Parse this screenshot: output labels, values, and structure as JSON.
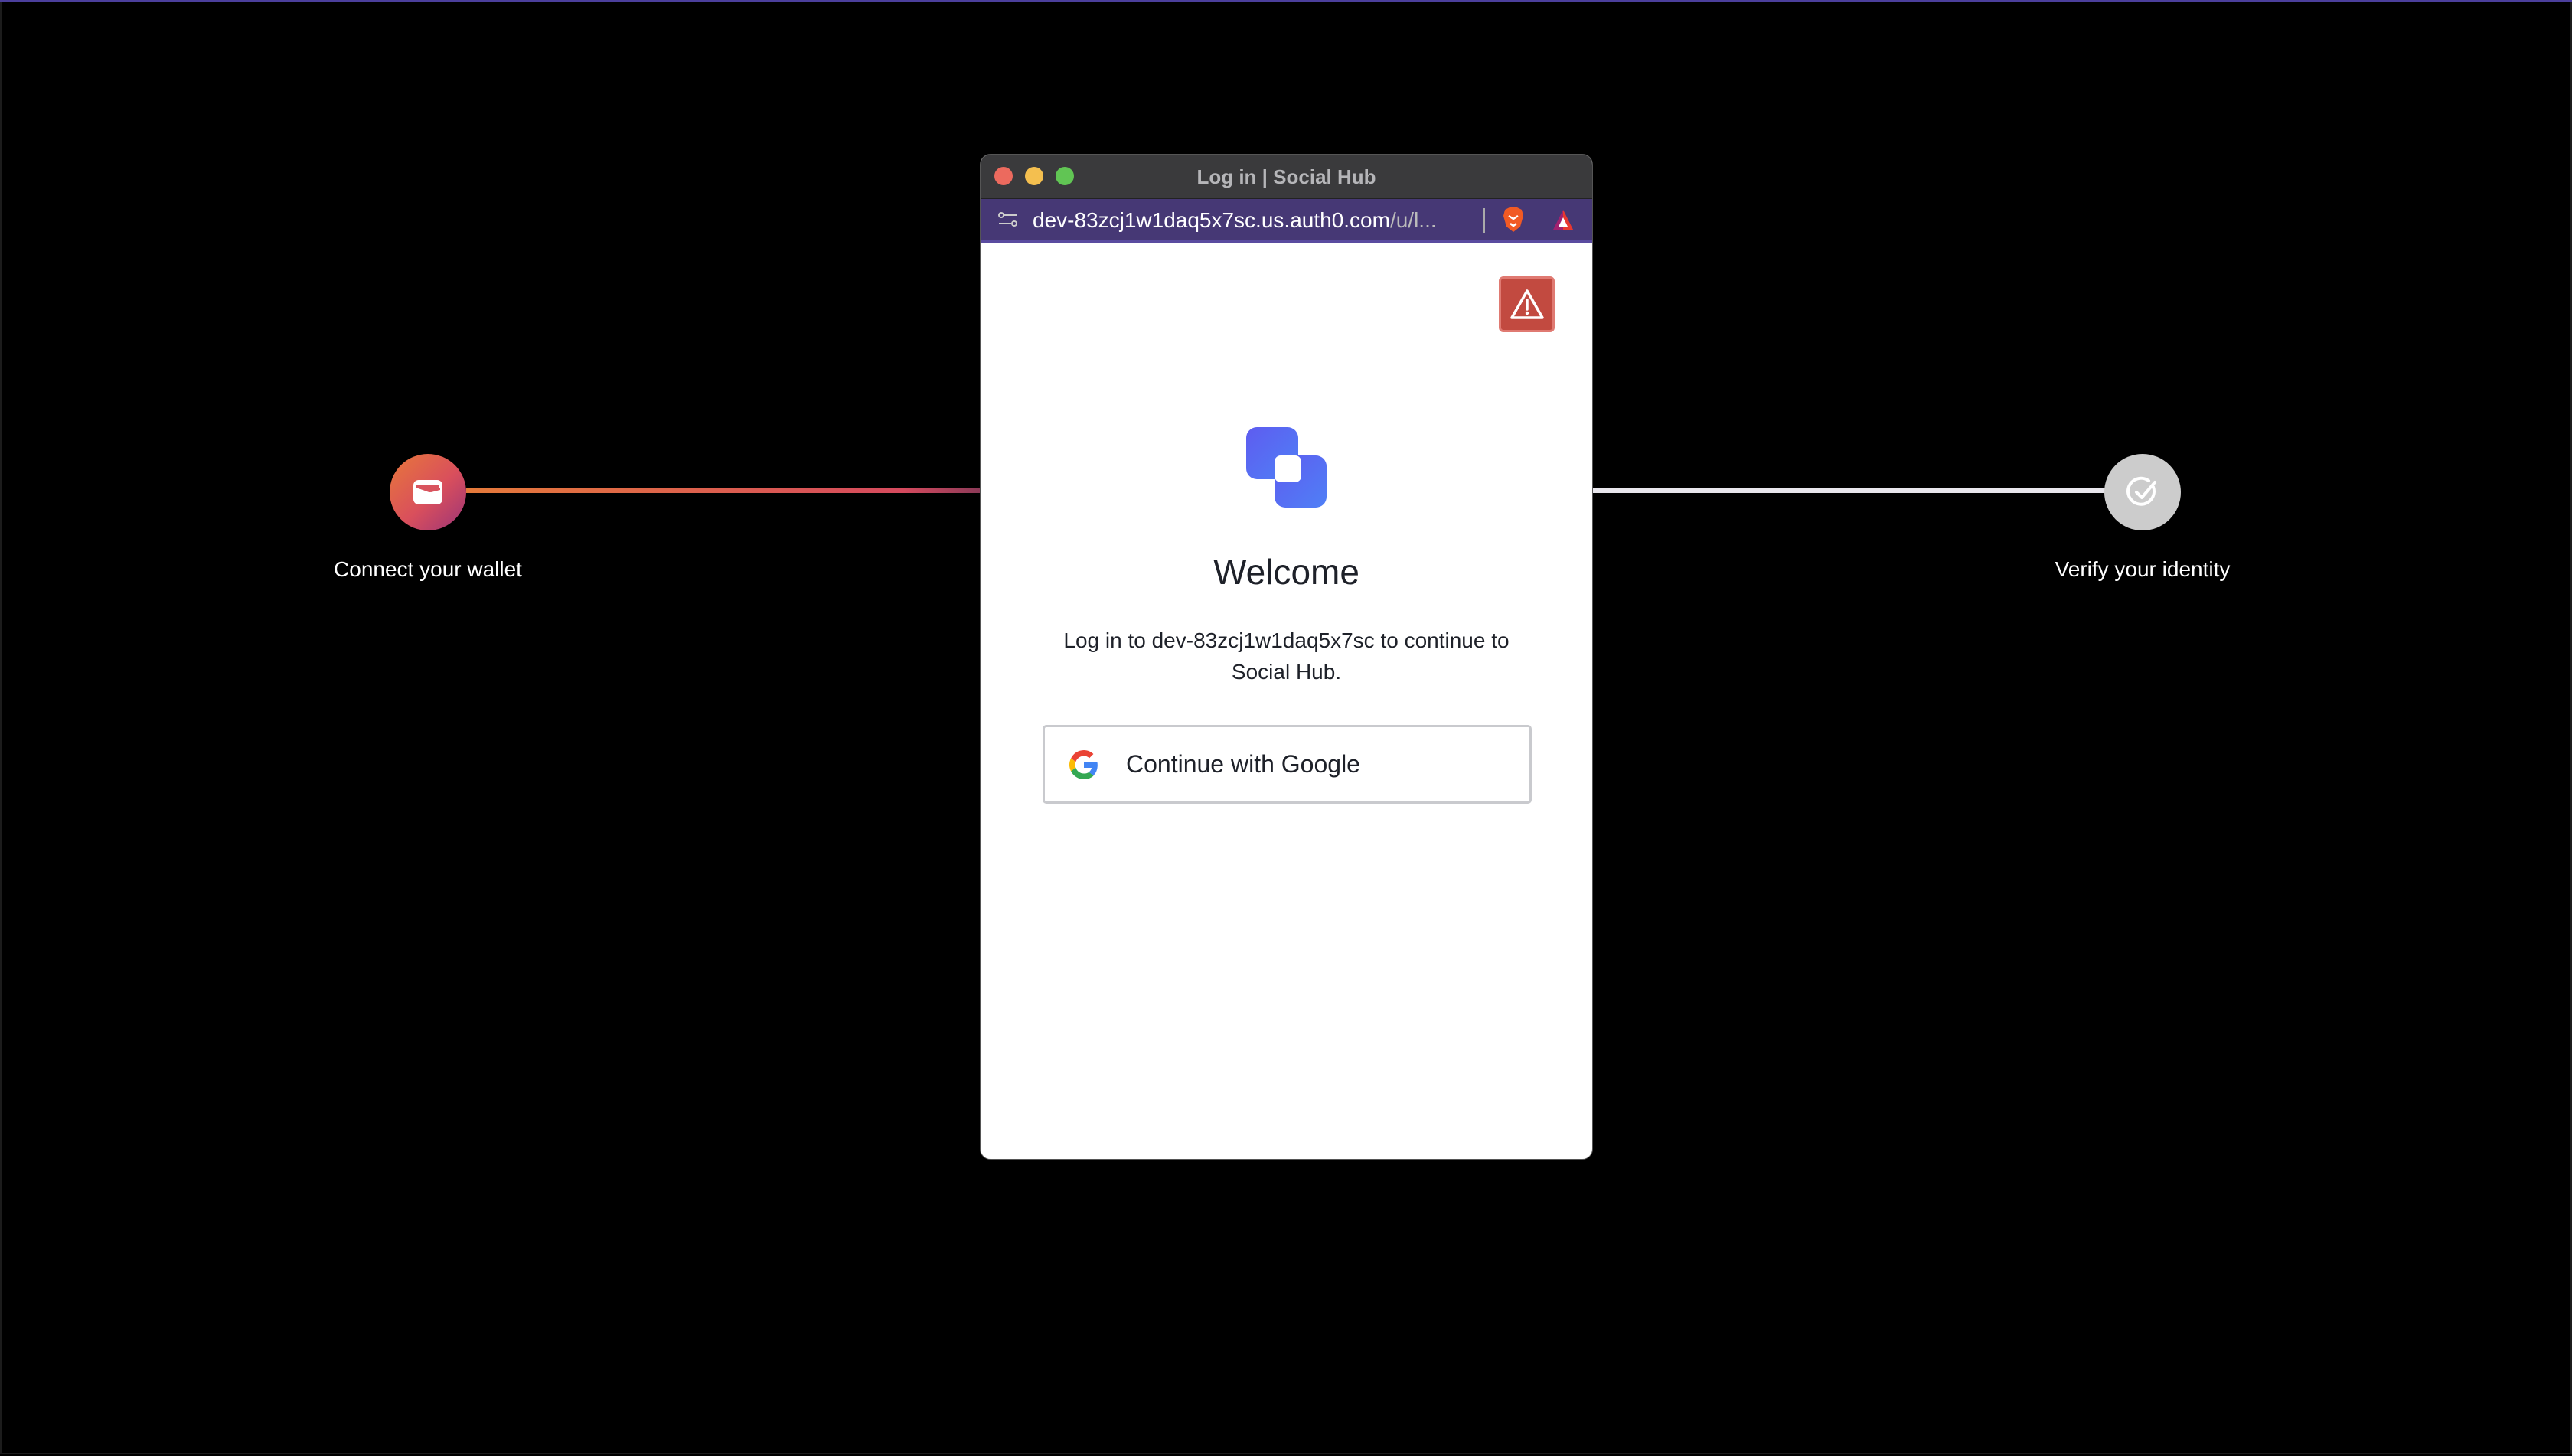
{
  "steps": [
    {
      "label": "Connect your wallet",
      "icon": "wallet-icon",
      "state": "active"
    },
    {
      "label": "Verify your identity",
      "icon": "check-circle-icon",
      "state": "pending"
    }
  ],
  "window": {
    "title": "Log in | Social Hub",
    "url_main": "dev-83zcj1w1daq5x7sc.us.auth0.com",
    "url_rest": "/u/l..."
  },
  "login": {
    "heading": "Welcome",
    "description": "Log in to dev-83zcj1w1daq5x7sc to continue to Social Hub.",
    "google_button": "Continue with Google"
  },
  "colors": {
    "accent": "#5b5ff0",
    "warning": "#c24a40",
    "urlbar": "#463875"
  }
}
